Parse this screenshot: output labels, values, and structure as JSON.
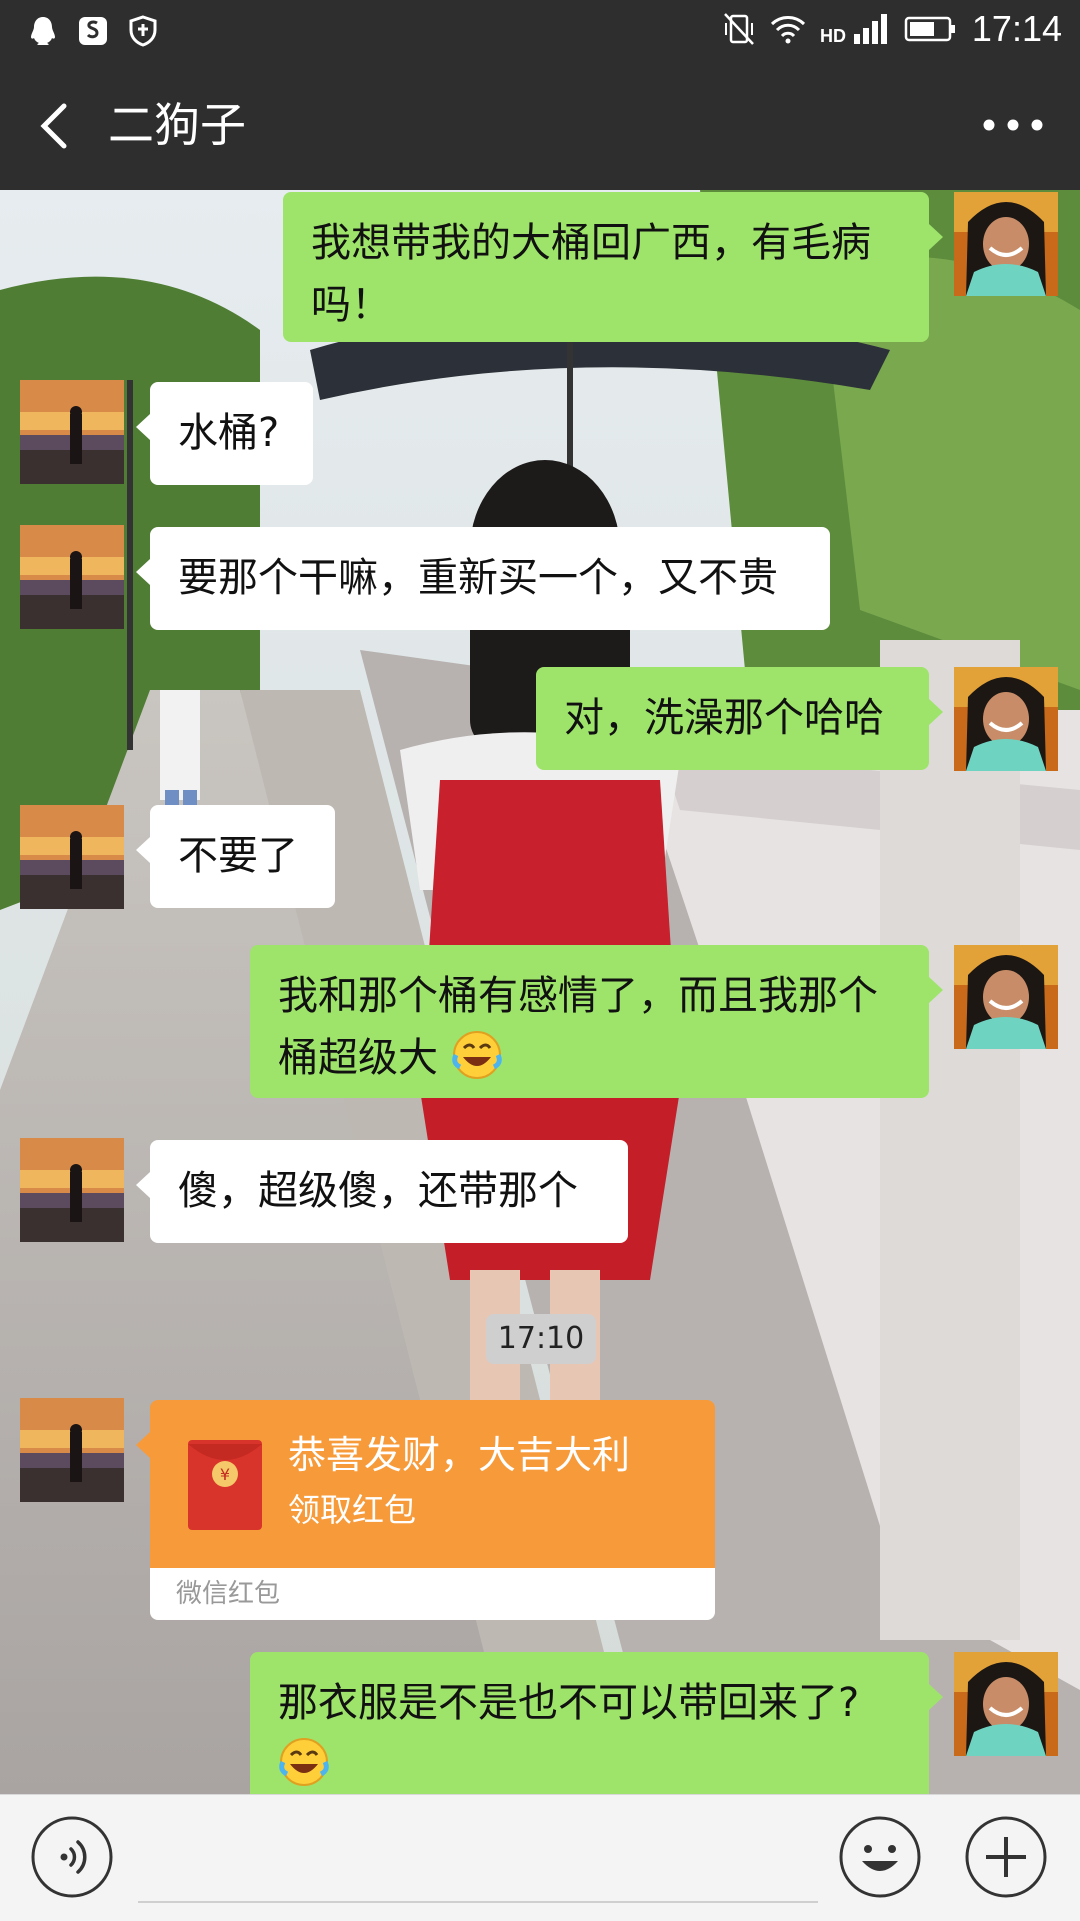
{
  "status_bar": {
    "time": "17:14",
    "left_icons": [
      "qq-icon",
      "soul-icon",
      "shield-icon"
    ],
    "right_icons": [
      "no-vibrate-icon",
      "wifi-icon",
      "hd-signal-icon",
      "battery-icon"
    ]
  },
  "header": {
    "title": "二狗子",
    "back_icon": "chevron-left-icon",
    "more_icon": "more-dots-icon"
  },
  "messages": [
    {
      "side": "out",
      "text": "我想带我的大桶回广西，有毛病吗！"
    },
    {
      "side": "in",
      "text": "水桶?"
    },
    {
      "side": "in",
      "text": "要那个干嘛，重新买一个，又不贵"
    },
    {
      "side": "out",
      "text": "对，洗澡那个哈哈"
    },
    {
      "side": "in",
      "text": "不要了"
    },
    {
      "side": "out",
      "text": "我和那个桶有感情了，而且我那个桶超级大",
      "emoji": "laughing-tears-emoji"
    },
    {
      "side": "in",
      "text": "傻，超级傻，还带那个"
    },
    {
      "side": "out",
      "text": "那衣服是不是也不可以带回来了?",
      "emoji": "laughing-tears-emoji"
    }
  ],
  "time_divider": "17:10",
  "red_packet": {
    "title": "恭喜发财，大吉大利",
    "subtitle": "领取红包",
    "footer": "微信红包",
    "color": "#f79a3a"
  },
  "input_bar": {
    "voice_icon": "voice-icon",
    "emoji_icon": "smiley-icon",
    "plus_icon": "plus-icon"
  },
  "colors": {
    "header_bg": "#2e2e2e",
    "outgoing_bubble": "#9ee46a",
    "incoming_bubble": "#ffffff"
  }
}
